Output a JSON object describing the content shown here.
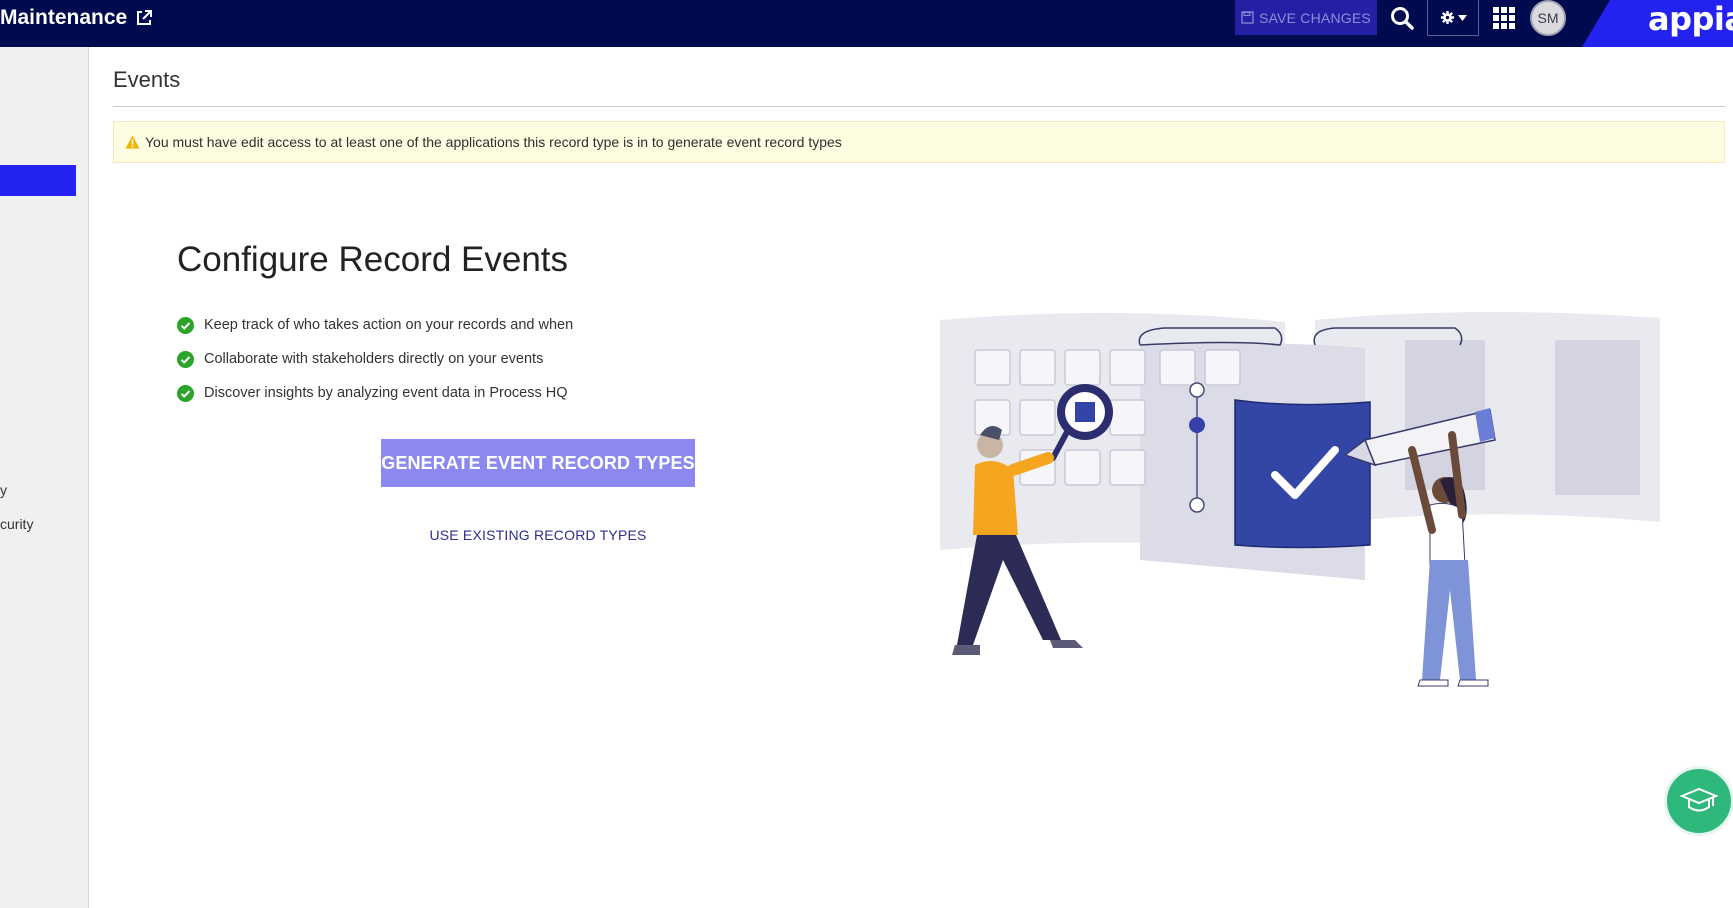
{
  "header": {
    "app_title": "Maintenance",
    "save_label": "SAVE CHANGES",
    "avatar_initials": "SM",
    "brand": "appian"
  },
  "sidebar": {
    "items": [
      {
        "label": "y"
      },
      {
        "label": "curity"
      }
    ]
  },
  "main": {
    "page_title": "Events",
    "warning": "You must have edit access to at least one of the applications this record type is in to generate event record types",
    "heading": "Configure Record Events",
    "benefits": [
      "Keep track of who takes action on your records and when",
      "Collaborate with stakeholders directly on your events",
      "Discover insights by analyzing event data in Process HQ"
    ],
    "generate_label": "GENERATE EVENT RECORD TYPES",
    "use_existing_label": "USE EXISTING RECORD TYPES"
  },
  "colors": {
    "topbar": "#000a4e",
    "accent": "#2322f0",
    "primary_button_disabled": "#8b89ef",
    "success": "#2aa52a",
    "help_fab": "#2fb87c"
  },
  "icons": {
    "external": "external-link-icon",
    "save": "save-icon",
    "search": "search-icon",
    "gear": "gear-icon",
    "apps": "grid-icon",
    "warning": "warning-icon",
    "check": "check-circle-icon",
    "help": "graduation-cap-icon"
  }
}
